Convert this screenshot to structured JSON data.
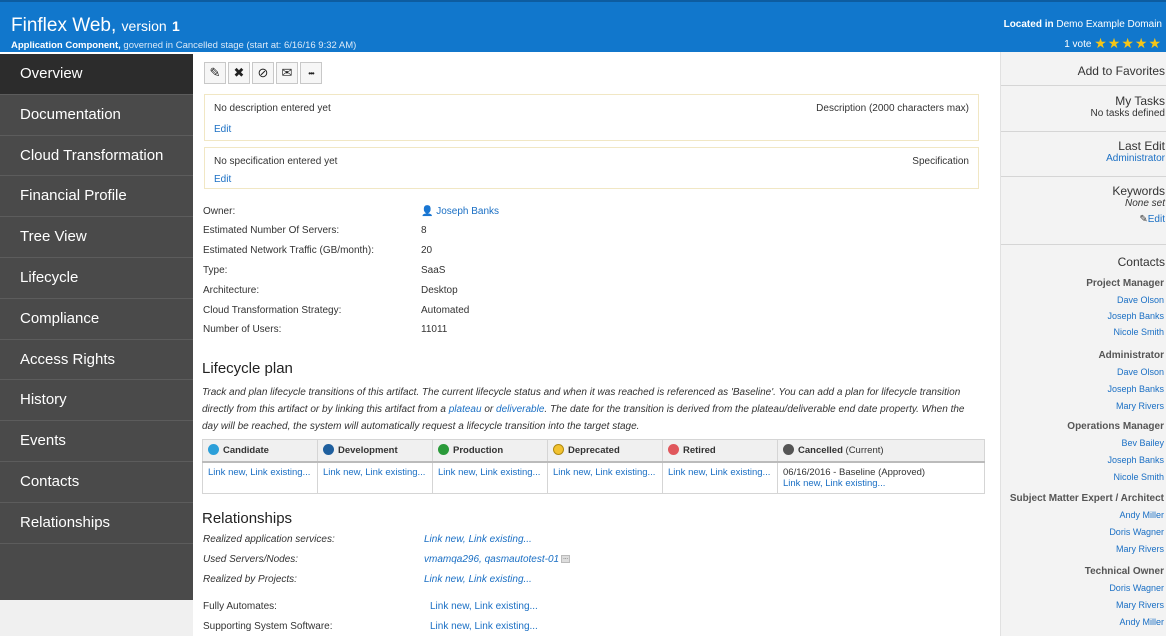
{
  "header": {
    "title": "Finflex Web,",
    "version_prefix": "version",
    "version_number": "1",
    "sub_bold": "Application Component,",
    "sub_rest": "governed in Cancelled stage (start at: 6/16/16 9:32 AM)",
    "location_prefix": "Located in",
    "location": "Demo Example Domain",
    "vote_text": "1 vote",
    "rating_stars": "★★★★★",
    "rating": 5
  },
  "sidebar": {
    "items": [
      "Overview",
      "Documentation",
      "Cloud Transformation",
      "Financial Profile",
      "Tree View",
      "Lifecycle",
      "Compliance",
      "Access Rights",
      "History",
      "Events",
      "Contacts",
      "Relationships"
    ],
    "active": "Overview"
  },
  "toolbar": {
    "edit_glyph": "✎",
    "delete_glyph": "✖",
    "compass_glyph": "⊘",
    "mail_glyph": "✉",
    "more_glyph": "•••"
  },
  "description": {
    "text": "No description entered yet",
    "label": "Description (2000 characters max)",
    "edit": "Edit"
  },
  "specification": {
    "text": "No specification entered yet",
    "label": "Specification",
    "edit": "Edit"
  },
  "properties": [
    {
      "label": "Owner:",
      "value": "Joseph Banks"
    },
    {
      "label": "Estimated Number Of Servers:",
      "value": "8"
    },
    {
      "label": "Estimated Network Traffic (GB/month):",
      "value": "20"
    },
    {
      "label": "Type:",
      "value": "SaaS"
    },
    {
      "label": "Architecture:",
      "value": "Desktop"
    },
    {
      "label": "Cloud Transformation Strategy:",
      "value": "Automated"
    },
    {
      "label": "Number of Users:",
      "value": "11011"
    }
  ],
  "lifecycle": {
    "heading": "Lifecycle plan",
    "para_1": "Track and plan lifecycle transitions of this artifact. The current lifecycle status and when it was reached is referenced as 'Baseline'. You can add a plan for lifecycle transition directly from this artifact or by linking this artifact from a",
    "plateau": "plateau",
    "or": "or",
    "deliverable": "deliverable",
    "para_2": ". The date for the transition is derived from the plateau/deliverable end date property. When the day will be reached, the system will automatically request a lifecycle transition into the target stage.",
    "stages": [
      {
        "name": "Candidate",
        "color": "#2b9fd9",
        "cell": "Link new, Link existing..."
      },
      {
        "name": "Development",
        "color": "#1f5f9e",
        "cell": "Link new, Link existing..."
      },
      {
        "name": "Production",
        "color": "#2a9a3a",
        "cell": "Link new, Link existing..."
      },
      {
        "name": "Deprecated",
        "color": "#f2c230",
        "cell": "Link new, Link existing..."
      },
      {
        "name": "Retired",
        "color": "#e0575c",
        "cell": "Link new, Link existing..."
      },
      {
        "name": "Cancelled",
        "color": "#555555",
        "note": "(Current)",
        "baseline": "06/16/2016 - Baseline (Approved)",
        "cell": "Link new, Link existing..."
      }
    ]
  },
  "relationships": {
    "heading": "Relationships",
    "rows": [
      {
        "label": "Realized application services:",
        "value": "Link new, Link existing..."
      },
      {
        "label": "Used Servers/Nodes:",
        "value": "vmamqa296, qasmautotest-01"
      },
      {
        "label": "Realized by Projects:",
        "value": "Link new, Link existing..."
      },
      {
        "label": "Fully Automates:",
        "value": "Link new, Link existing..."
      },
      {
        "label": "Supporting System Software:",
        "value": "Link new, Link existing..."
      }
    ],
    "more_glyph": "..."
  },
  "right_panel": {
    "add_favorites": "Add to Favorites",
    "my_tasks": "My Tasks",
    "no_tasks": "No tasks defined",
    "last_edit": "Last Edit",
    "last_edit_by": "Administrator",
    "keywords": "Keywords",
    "none_set": "None set",
    "edit": "Edit",
    "edit_glyph": "✎",
    "contacts": "Contacts",
    "groups": [
      {
        "role": "Project Manager",
        "names": [
          "Dave Olson",
          "Joseph Banks",
          "Nicole Smith"
        ]
      },
      {
        "role": "Administrator",
        "names": [
          "Dave Olson",
          "Joseph Banks",
          "Mary Rivers"
        ]
      },
      {
        "role": "Operations Manager",
        "names": [
          "Bev Bailey",
          "Joseph Banks",
          "Nicole Smith"
        ]
      },
      {
        "role": "Subject Matter Expert / Architect",
        "names": [
          "Andy Miller",
          "Doris Wagner",
          "Mary Rivers"
        ]
      },
      {
        "role": "Technical Owner",
        "names": [
          "Doris Wagner",
          "Mary Rivers",
          "Andy Miller"
        ]
      }
    ]
  }
}
